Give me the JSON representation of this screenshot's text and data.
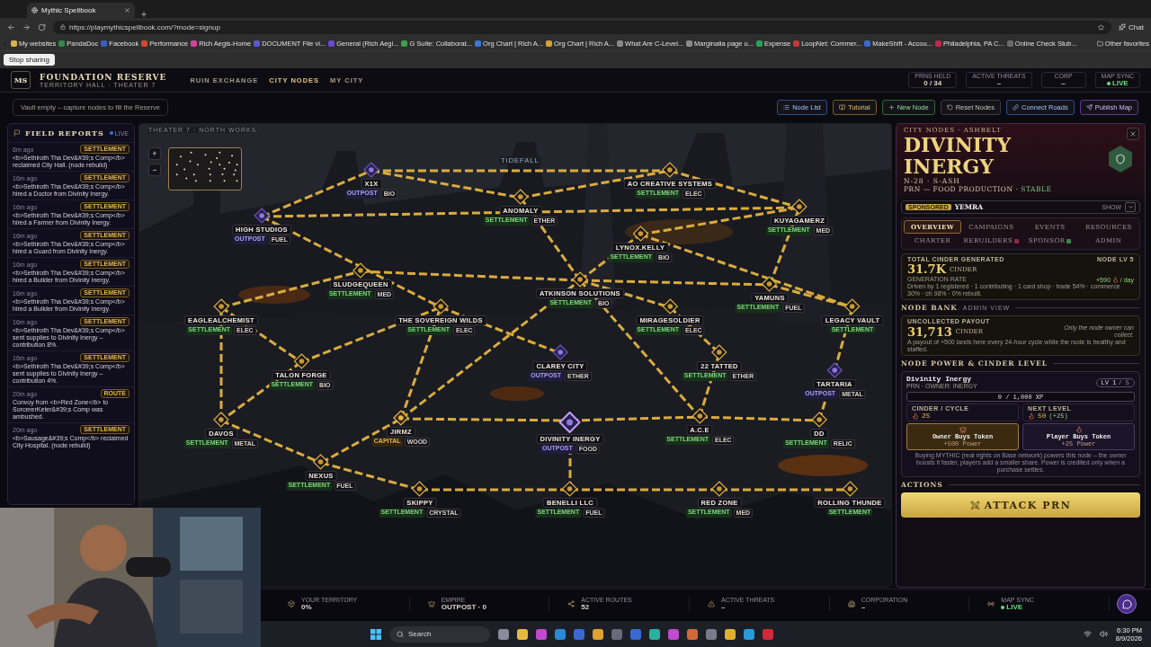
{
  "browser": {
    "tab_title": "Mythic Spellbook",
    "url": "https://playmythicspellbook.com/?mode=signup",
    "chat": "Chat",
    "bookmarks": [
      "My websites",
      "PandaDoc",
      "Facebook",
      "Performance",
      "Rich Aegis-Home",
      "DOCUMENT File vi...",
      "General (Rich Aegi...",
      "G Suite: Collaborat...",
      "Org Chart | Rich A...",
      "Org Chart | Rich A...",
      "What Are C-Level...",
      "Marginalia page u...",
      "Expense",
      "LoopNet: Commer...",
      "MakeShift - Accou...",
      "Philadelphia, PA C...",
      "Online Check Stub..."
    ],
    "other_favorites": "Other favorites",
    "stop_sharing": "Stop sharing"
  },
  "header": {
    "logo": "MS",
    "title": "FOUNDATION RESERVE",
    "subtitle": "TERRITORY HALL · THEATER 7",
    "nav": [
      {
        "label": "RUIN EXCHANGE",
        "selected": false
      },
      {
        "label": "CITY NODES",
        "selected": true
      },
      {
        "label": "MY CITY",
        "selected": false
      }
    ],
    "stats": [
      {
        "label": "PRNS HELD",
        "value": "0 / 34",
        "kind": "plain"
      },
      {
        "label": "ACTIVE THREATS",
        "value": "–",
        "kind": "plain"
      },
      {
        "label": "CORP",
        "value": "–",
        "kind": "plain"
      },
      {
        "label": "MAP SYNC",
        "value": "LIVE",
        "kind": "live"
      }
    ]
  },
  "toolbar": {
    "vault_note": "Vault empty – capture nodes to fill the Reserve",
    "buttons": [
      {
        "label": "Node List",
        "kind": "blue"
      },
      {
        "label": "Tutorial",
        "kind": "gold"
      },
      {
        "label": "New Node",
        "kind": "green"
      },
      {
        "label": "Reset Nodes",
        "kind": "plain"
      },
      {
        "label": "Connect Roads",
        "kind": "blue"
      },
      {
        "label": "Publish Map",
        "kind": "purple"
      }
    ]
  },
  "field_reports": {
    "title": "FIELD REPORTS",
    "live": "LIVE",
    "items": [
      {
        "time": "6m ago",
        "tag": "SETTLEMENT",
        "text": "<b>Sethiroth Tha Dev&#39;s Comp</b> reclaimed City Hall. (node rebuild)"
      },
      {
        "time": "16m ago",
        "tag": "SETTLEMENT",
        "text": "<b>Sethiroth Tha Dev&#39;s Comp</b> hired a Doctor from Divinity Inergy."
      },
      {
        "time": "16m ago",
        "tag": "SETTLEMENT",
        "text": "<b>Sethiroth Tha Dev&#39;s Comp</b> hired a Farmer from Divinity Inergy."
      },
      {
        "time": "16m ago",
        "tag": "SETTLEMENT",
        "text": "<b>Sethiroth Tha Dev&#39;s Comp</b> hired a Guard from Divinity Inergy."
      },
      {
        "time": "16m ago",
        "tag": "SETTLEMENT",
        "text": "<b>Sethiroth Tha Dev&#39;s Comp</b> hired a Builder from Divinity Inergy."
      },
      {
        "time": "16m ago",
        "tag": "SETTLEMENT",
        "text": "<b>Sethiroth Tha Dev&#39;s Comp</b> hired a Builder from Divinity Inergy."
      },
      {
        "time": "16m ago",
        "tag": "SETTLEMENT",
        "text": "<b>Sethiroth Tha Dev&#39;s Comp</b> sent supplies to Divinity Inergy – contribution 8%."
      },
      {
        "time": "16m ago",
        "tag": "SETTLEMENT",
        "text": "<b>Sethiroth Tha Dev&#39;s Comp</b> sent supplies to Divinity Inergy – contribution 4%."
      },
      {
        "time": "20m ago",
        "tag": "ROUTE",
        "text": "Convoy from <b>Red Zone</b> to SorcererKeter&#39;s Comp was ambushed."
      },
      {
        "time": "20m ago",
        "tag": "SETTLEMENT",
        "text": "<b>Sausage&#39;s Comp</b> reclaimed City Hospital. (node rebuild)"
      }
    ]
  },
  "map": {
    "breadcrumb": "THEATER 7 · NORTH WORKS",
    "zoom_in": "+",
    "zoom_out": "−",
    "region_label": "TIDEFALL",
    "nodes": [
      {
        "name": "X1X",
        "type": "OUTPOST",
        "resource": "BIO",
        "selected": false
      },
      {
        "name": "HIGH STUDIOS",
        "type": "OUTPOST",
        "resource": "FUEL",
        "selected": false
      },
      {
        "name": "ANOMALY",
        "type": "SETTLEMENT",
        "resource": "ETHER",
        "selected": false
      },
      {
        "name": "AO CREATIVE SYSTEMS",
        "type": "SETTLEMENT",
        "resource": "ELEC",
        "selected": false
      },
      {
        "name": "KUYAGAMERZ",
        "type": "SETTLEMENT",
        "resource": "MED",
        "selected": false
      },
      {
        "name": "LYNOX.KELLY",
        "type": "SETTLEMENT",
        "resource": "BIO",
        "selected": false
      },
      {
        "name": "SLUDGEQUEEN",
        "type": "SETTLEMENT",
        "resource": "MED",
        "selected": false
      },
      {
        "name": "ATKINSON SOLUTIONS",
        "type": "SETTLEMENT",
        "resource": "BIO",
        "selected": false
      },
      {
        "name": "YAMUNS",
        "type": "SETTLEMENT",
        "resource": "FUEL",
        "selected": false
      },
      {
        "name": "EAGLEALCHEMIST",
        "type": "SETTLEMENT",
        "resource": "ELEC",
        "selected": false
      },
      {
        "name": "THE SOVEREIGN WILDS",
        "type": "SETTLEMENT",
        "resource": "ELEC",
        "selected": false
      },
      {
        "name": "MIRAGESOLDIER",
        "type": "SETTLEMENT",
        "resource": "ELEC",
        "selected": false
      },
      {
        "name": "LEGACY VAULT",
        "type": "SETTLEMENT",
        "selected": false
      },
      {
        "name": "CLAREY CITY",
        "type": "OUTPOST",
        "resource": "ETHER",
        "selected": false
      },
      {
        "name": "22 TATTED",
        "type": "SETTLEMENT",
        "resource": "ETHER",
        "selected": false
      },
      {
        "name": "TALON FORGE",
        "type": "SETTLEMENT",
        "resource": "BIO",
        "selected": false
      },
      {
        "name": "TARTARIA",
        "type": "OUTPOST",
        "resource": "METAL",
        "selected": false
      },
      {
        "name": "DAVOS",
        "type": "SETTLEMENT",
        "resource": "METAL",
        "selected": false
      },
      {
        "name": "JIRMZ",
        "type": "CAPITAL",
        "resource": "WOOD",
        "selected": false
      },
      {
        "name": "DIVINITY INERGY",
        "type": "OUTPOST",
        "resource": "FOOD",
        "selected": true
      },
      {
        "name": "A.C.E",
        "type": "SETTLEMENT",
        "resource": "ELEC",
        "selected": false
      },
      {
        "name": "DD",
        "type": "SETTLEMENT",
        "resource": "RELIC",
        "selected": false
      },
      {
        "name": "NEXUS",
        "type": "SETTLEMENT",
        "resource": "FUEL",
        "selected": false
      },
      {
        "name": "SKIPPY",
        "type": "SETTLEMENT",
        "resource": "CRYSTAL",
        "selected": false
      },
      {
        "name": "BENELLI LLC",
        "type": "SETTLEMENT",
        "resource": "FUEL",
        "selected": false
      },
      {
        "name": "RED ZONE",
        "type": "SETTLEMENT",
        "resource": "MED",
        "selected": false
      },
      {
        "name": "ROLLING THUNDE",
        "type": "SETTLEMENT",
        "selected": false
      }
    ]
  },
  "detail": {
    "breadcrumb": "CITY NODES · ASHBELT",
    "title": "DIVINITY INERGY",
    "code": "N-28 · S-ASH",
    "production": "PRN — FOOD PRODUCTION ·",
    "status": "STABLE",
    "sponsor": {
      "badge": "SPONSORED",
      "name": "YEMRA",
      "toggle": "SHOW"
    },
    "tabs": [
      {
        "label": "OVERVIEW",
        "selected": true
      },
      {
        "label": "CAMPAIGNS",
        "selected": false
      },
      {
        "label": "EVENTS",
        "selected": false
      },
      {
        "label": "RESOURCES",
        "selected": false
      },
      {
        "label": "CHARTER",
        "selected": false
      },
      {
        "label": "REBUILDERS",
        "selected": false,
        "color": "#8a2b4a"
      },
      {
        "label": "SPONSOR",
        "selected": false,
        "color": "#2f8a4a"
      },
      {
        "label": "ADMIN",
        "selected": false
      }
    ],
    "cinder": {
      "label": "TOTAL CINDER GENERATED",
      "node_level": "NODE LV 5",
      "amount": "31.7K",
      "unit": "CINDER",
      "rate_label": "GENERATION RATE",
      "rate": "+590",
      "rate_unit": "/ day",
      "note": "Driven by 1 registered · 1 contributing · 1 card shop · trade 54% · commerce 30% · ch 98% · 0% rebuilt."
    },
    "bank": {
      "heading": "NODE BANK",
      "tag": "ADMIN VIEW",
      "label": "UNCOLLECTED PAYOUT",
      "amount": "31,713",
      "unit": "CINDER",
      "owner_note": "Only the node owner can collect.",
      "note": "A payout of +500 lands here every 24-hour cycle while the node is healthy and staffed."
    },
    "power": {
      "heading": "NODE POWER & CINDER LEVEL",
      "name": "Divinity Inergy",
      "owner": "PRN · OWNER: INERGY",
      "lv": "LV 1",
      "lv_max": "/ 5",
      "xp": {
        "text": "0 / 1,000 XP",
        "level": 0
      },
      "stats": [
        {
          "label": "CINDER / CYCLE",
          "value": "25"
        },
        {
          "label": "NEXT LEVEL",
          "value": "50",
          "delta": "(+25)"
        }
      ],
      "tokens": [
        {
          "title": "Owner Buys Token",
          "bonus": "+500 Power",
          "selected": true
        },
        {
          "title": "Player Buys Token",
          "bonus": "+25 Power",
          "selected": false
        }
      ],
      "note": "Buying MYTHIC (real rights on Base network) powers this node – the owner boosts it faster, players add a smaller share. Power is credited only when a purchase settles."
    },
    "actions": {
      "heading": "ACTIONS",
      "attack": "ATTACK PRN"
    }
  },
  "status_bar": [
    {
      "label": "YOUR TERRITORY",
      "value": "0%",
      "kind": "plain"
    },
    {
      "label": "EMPIRE",
      "value": "OUTPOST · 0",
      "kind": "plain"
    },
    {
      "label": "ACTIVE ROUTES",
      "value": "52",
      "kind": "plain"
    },
    {
      "label": "ACTIVE THREATS",
      "value": "–",
      "kind": "plain"
    },
    {
      "label": "CORPORATION",
      "value": "–",
      "kind": "plain"
    },
    {
      "label": "MAP SYNC",
      "value": "LIVE",
      "kind": "live"
    }
  ],
  "taskbar": {
    "search": "Search",
    "time": "6:30 PM",
    "date": "8/9/2026"
  }
}
